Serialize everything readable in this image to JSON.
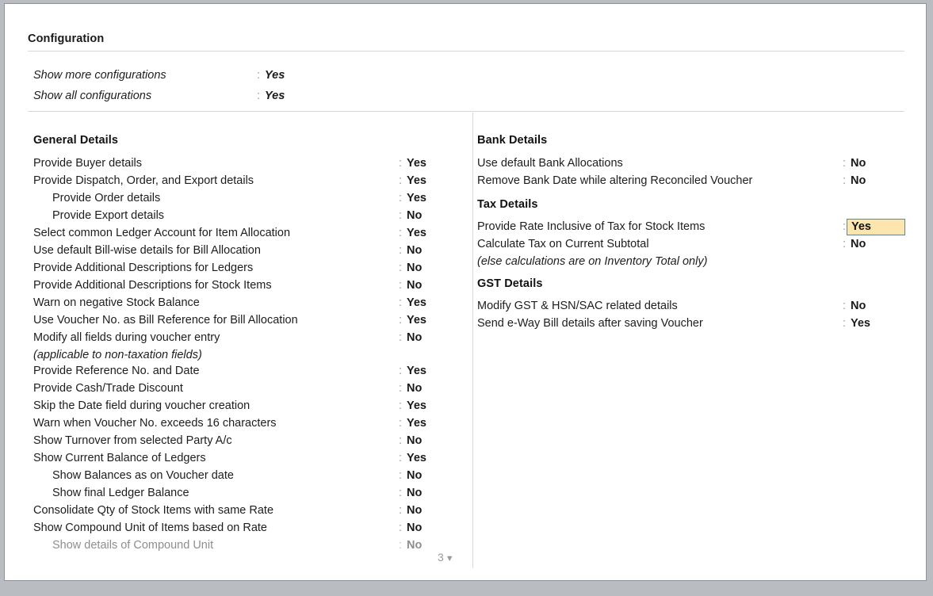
{
  "window": {
    "title": "Configuration"
  },
  "top_config": {
    "rows": [
      {
        "label": "Show more configurations",
        "value": "Yes"
      },
      {
        "label": "Show all configurations",
        "value": "Yes"
      }
    ]
  },
  "left_column": {
    "section_title": "General Details",
    "rows": [
      {
        "label": "Provide Buyer details",
        "value": "Yes"
      },
      {
        "label": "Provide Dispatch, Order, and Export details",
        "value": "Yes"
      },
      {
        "label": "Provide Order details",
        "value": "Yes"
      },
      {
        "label": "Provide Export details",
        "value": "No"
      },
      {
        "label": "Select common Ledger Account for Item Allocation",
        "value": "Yes"
      },
      {
        "label": "Use default Bill-wise details for Bill Allocation",
        "value": "No"
      },
      {
        "label": "Provide Additional Descriptions for Ledgers",
        "value": "No"
      },
      {
        "label": "Provide Additional Descriptions for Stock Items",
        "value": "No"
      },
      {
        "label": "Warn on negative Stock Balance",
        "value": "Yes"
      },
      {
        "label": "Use Voucher No. as Bill Reference for Bill Allocation",
        "value": "Yes"
      },
      {
        "label": "Modify all fields during voucher entry",
        "value": "No"
      },
      {
        "label": "(applicable to non-taxation fields)",
        "value": ""
      },
      {
        "label": "Provide Reference No. and Date",
        "value": "Yes"
      },
      {
        "label": "Provide Cash/Trade Discount",
        "value": "No"
      },
      {
        "label": "Skip the Date field during voucher creation",
        "value": "Yes"
      },
      {
        "label": "Warn when Voucher No. exceeds 16 characters",
        "value": "Yes"
      },
      {
        "label": "Show Turnover from selected Party A/c",
        "value": "No"
      },
      {
        "label": "Show Current Balance of Ledgers",
        "value": "Yes"
      },
      {
        "label": "Show Balances as on Voucher date",
        "value": "No"
      },
      {
        "label": "Show final Ledger Balance",
        "value": "No"
      },
      {
        "label": "Consolidate Qty of Stock Items with same Rate",
        "value": "No"
      },
      {
        "label": "Show Compound Unit of Items based on Rate",
        "value": "No"
      },
      {
        "label": "Show details of Compound Unit",
        "value": "No"
      }
    ]
  },
  "right_column": {
    "bank": {
      "section_title": "Bank Details",
      "rows": [
        {
          "label": "Use default Bank Allocations",
          "value": "No"
        },
        {
          "label": "Remove Bank Date while altering Reconciled Voucher",
          "value": "No"
        }
      ]
    },
    "tax": {
      "section_title": "Tax Details",
      "rows": [
        {
          "label": "Provide Rate Inclusive of Tax for Stock Items",
          "value": "Yes"
        },
        {
          "label": "Calculate Tax on Current Subtotal",
          "value": "No"
        },
        {
          "label": "(else calculations are on Inventory Total only)",
          "value": ""
        }
      ]
    },
    "gst": {
      "section_title": "GST Details",
      "rows": [
        {
          "label": "Modify GST & HSN/SAC related details",
          "value": "No"
        },
        {
          "label": "Send e-Way Bill details after saving Voucher",
          "value": "Yes"
        }
      ]
    }
  },
  "scroll_indicator": {
    "count": "3",
    "caret": "▼"
  },
  "colors": {
    "highlight_background": "#fde5ae",
    "highlight_border": "#5a8a8f",
    "separator": "#d8d8d8",
    "muted_text": "#8e8e8e"
  },
  "symbols": {
    "colon": ":"
  }
}
